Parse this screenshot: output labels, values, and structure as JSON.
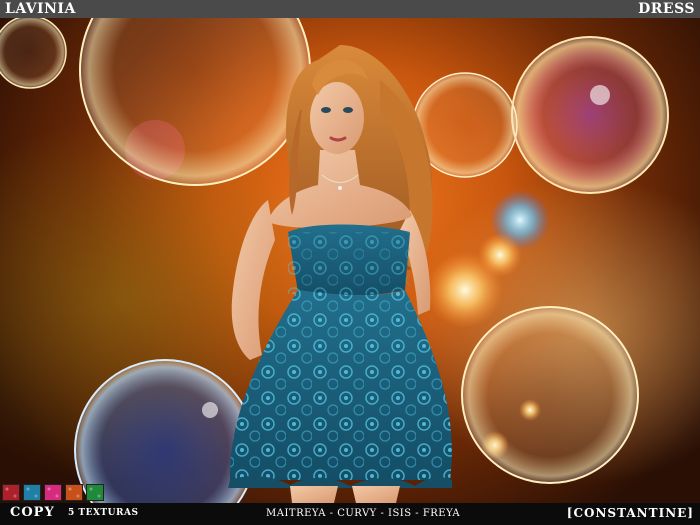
{
  "header": {
    "title": "LAVINIA",
    "category": "DRESS"
  },
  "footer": {
    "permission": "COPY",
    "textures_label": "5 TEXTURAS",
    "body_types": "MAITREYA - CURVY - ISIS - FREYA",
    "brand": "[CONSTANTINE]"
  },
  "swatches": [
    "#b0202a",
    "#1f7fa6",
    "#d82a7e",
    "#c8501a",
    "#1e8a3a"
  ],
  "dress": {
    "color": "#1e6f8e",
    "pattern": "floral-icon"
  }
}
